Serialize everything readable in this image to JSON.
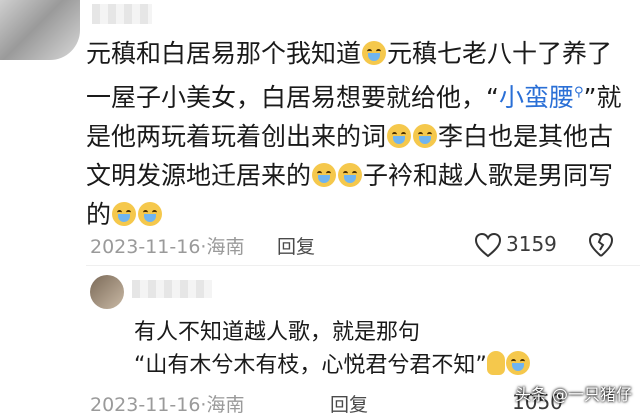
{
  "comment1": {
    "line1_a": "元稹和白居易那个我知道",
    "line1_b": "元稹七老八十了养了",
    "line2_a": "一屋子小美女，白居易想要就给他，“",
    "line2_link": "小蛮腰",
    "line2_b": "”就",
    "line3_a": "是他两玩着玩着创出来的词",
    "line3_b": "李白也是其他古",
    "line4_a": "文明发源地迁居来的",
    "line4_b": "子衿和越人歌是男同写",
    "line5_a": "的",
    "date": "2023-11-16",
    "sep": "·",
    "location": "海南",
    "reply_label": "回复",
    "likes": "3159"
  },
  "comment2": {
    "line1": "有人不知道越人歌，就是那句",
    "line2": "“山有木兮木有枝，心悦君兮君不知”",
    "date": "2023-11-16",
    "sep": "·",
    "location": "海南",
    "reply_label": "回复",
    "likes": "1050"
  },
  "watermark": "头条 @一只猪仔",
  "icons": {
    "emoji": "crying-face-icon",
    "hand": "folded-hands-icon",
    "like": "heart-outline-icon",
    "dislike": "broken-heart-icon"
  }
}
